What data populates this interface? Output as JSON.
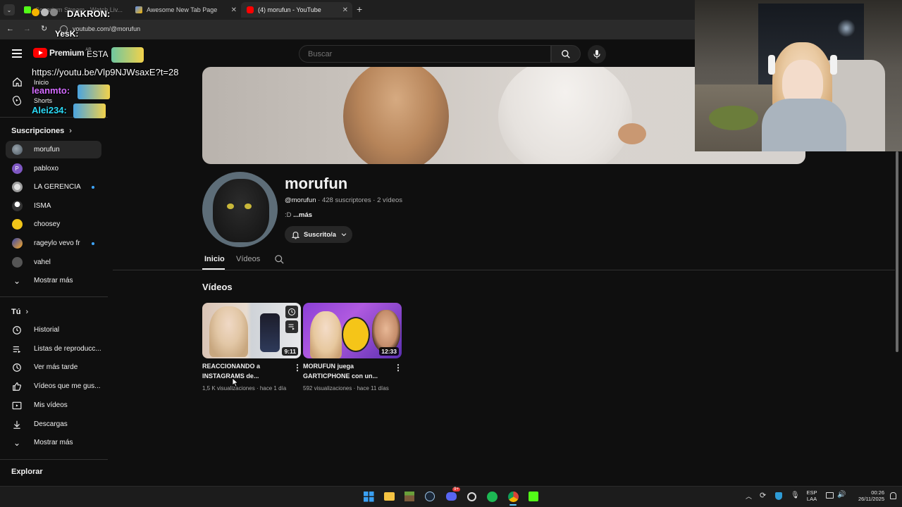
{
  "browser": {
    "tabs": [
      {
        "label": "Sonarium Stream · Watch Liv...",
        "favicon_color": "#53fc18"
      },
      {
        "label": "Awesome New Tab Page",
        "favicon_color": "#5b8def"
      },
      {
        "label": "(4) morufun - YouTube",
        "favicon_color": "#ff0000"
      }
    ],
    "new_tab": "+",
    "url": "youtube.com/@morufun"
  },
  "youtube": {
    "logo_text": "Premium",
    "logo_sup": "AR",
    "search_placeholder": "Buscar"
  },
  "sidebar": {
    "top": [
      {
        "label": "Inicio",
        "icon": "home-icon"
      },
      {
        "label": "Shorts",
        "icon": "shorts-icon"
      }
    ],
    "subscriptions_title": "Suscripciones",
    "subscriptions": [
      {
        "label": "morufun",
        "color": "#6b7a86",
        "active": true,
        "dot": false
      },
      {
        "label": "pabloxo",
        "color": "#7e57c2",
        "letter": "P",
        "dot": false
      },
      {
        "label": "LA GERENCIA",
        "color": "#9e9e9e",
        "dot": true
      },
      {
        "label": "ISMA",
        "color": "#ffffff",
        "dot": false
      },
      {
        "label": "choosey",
        "color": "#f0c419",
        "dot": false
      },
      {
        "label": "rageylo vevo fr",
        "color": "#3949ab",
        "dot": true
      },
      {
        "label": "vahel",
        "color": "#555555",
        "dot": false
      }
    ],
    "show_more_1": "Mostrar más",
    "you_title": "Tú",
    "you_items": [
      {
        "label": "Historial",
        "icon": "history-icon"
      },
      {
        "label": "Listas de reproducc...",
        "icon": "playlists-icon"
      },
      {
        "label": "Ver más tarde",
        "icon": "watch-later-icon"
      },
      {
        "label": "Vídeos que me gus...",
        "icon": "like-icon"
      },
      {
        "label": "Mis vídeos",
        "icon": "my-videos-icon"
      },
      {
        "label": "Descargas",
        "icon": "download-icon"
      }
    ],
    "show_more_2": "Mostrar más",
    "explore_title": "Explorar"
  },
  "overlay": {
    "dakron": "DAKRON:",
    "yesk": "YesK:",
    "esta": "ESTA",
    "link": "https://youtu.be/Vlp9NJWsaxE?t=28",
    "user1": "leanmto:",
    "user2": "Alei234:"
  },
  "channel": {
    "name": "morufun",
    "handle": "@morufun",
    "subscribers": "428 suscriptores",
    "video_count": "2 vídeos",
    "description": ":D",
    "more": "...más",
    "subscribe_label": "Suscrito/a",
    "tabs": [
      "Inicio",
      "Vídeos"
    ],
    "section_title": "Vídeos",
    "videos": [
      {
        "title_line1": "REACCIONANDO a",
        "title_line2": "INSTAGRAMS de...",
        "duration": "9:11",
        "views": "1,5 K visualizaciones",
        "age": "hace 1 día"
      },
      {
        "title_line1": "MORUFUN juega",
        "title_line2": "GARTICPHONE con un...",
        "duration": "12:33",
        "views": "592 visualizaciones",
        "age": "hace 11 días"
      }
    ]
  },
  "taskbar": {
    "lang1": "ESP",
    "lang2": "LAA",
    "time": "00:26",
    "date": "26/11/2025",
    "discord_badge": "9+"
  }
}
